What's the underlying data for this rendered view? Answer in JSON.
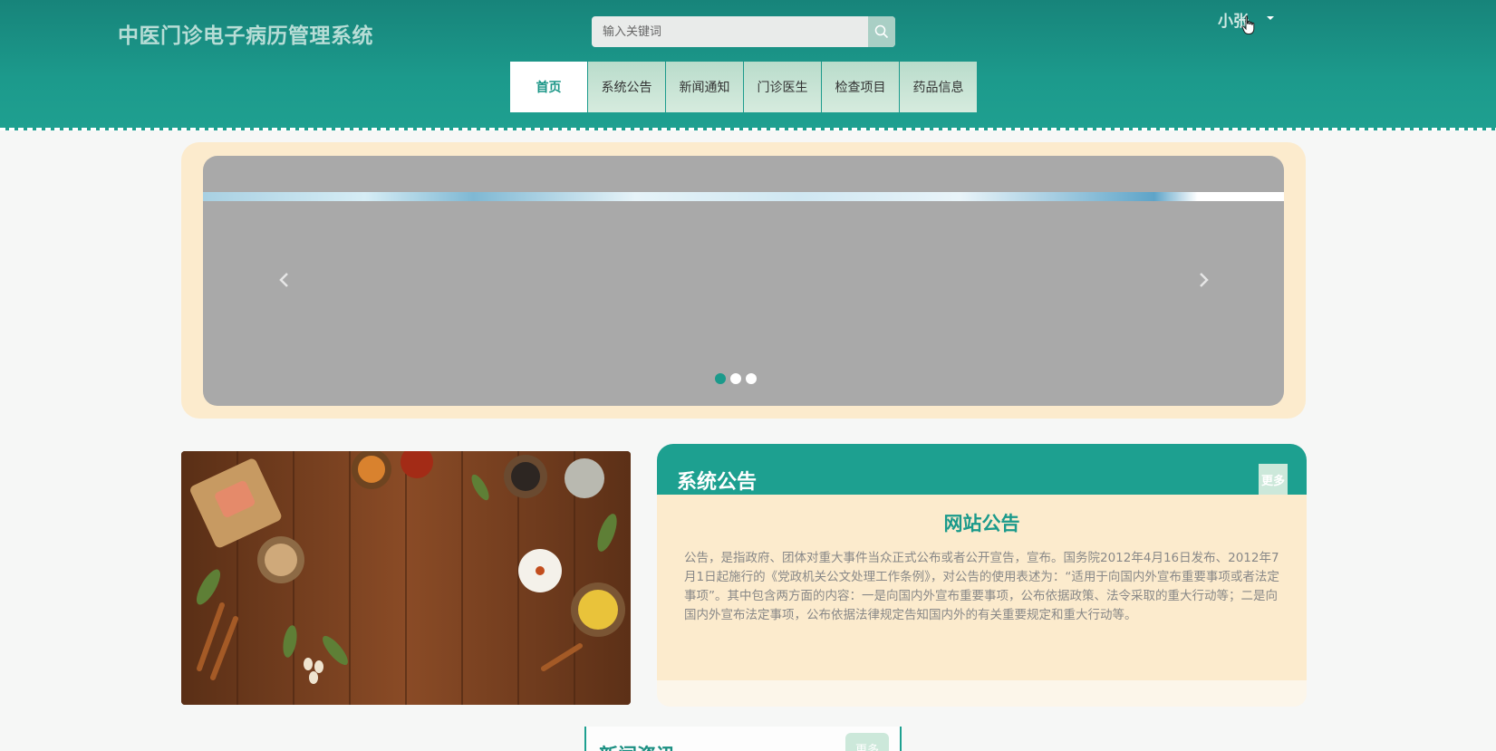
{
  "header": {
    "site_title": "中医门诊电子病历管理系统",
    "search_placeholder": "输入关键词",
    "user_name": "小张"
  },
  "nav": {
    "items": [
      {
        "label": "首页",
        "active": true
      },
      {
        "label": "系统公告",
        "active": false
      },
      {
        "label": "新闻通知",
        "active": false
      },
      {
        "label": "门诊医生",
        "active": false
      },
      {
        "label": "检查项目",
        "active": false
      },
      {
        "label": "药品信息",
        "active": false
      }
    ]
  },
  "carousel": {
    "slide_count": 3,
    "active_index": 0
  },
  "notice": {
    "title": "系统公告",
    "more_label": "更多",
    "heading": "网站公告",
    "text": "公告，是指政府、团体对重大事件当众正式公布或者公开宣告，宣布。国务院2012年4月16日发布、2012年7月1日起施行的《党政机关公文处理工作条例》，对公告的使用表述为：“适用于向国内外宣布重要事项或者法定事项”。其中包含两方面的内容：一是向国内外宣布重要事项，公布依据政策、法令采取的重大行动等；二是向国内外宣布法定事项，公布依据法律规定告知国内外的有关重要规定和重大行动等。"
  },
  "news": {
    "title": "新闻资讯",
    "more_label": "更多"
  },
  "colors": {
    "primary": "#1da090",
    "header_dark": "#17847a",
    "cream": "#fcebcd",
    "nav_bg": "#c6e3d3"
  }
}
